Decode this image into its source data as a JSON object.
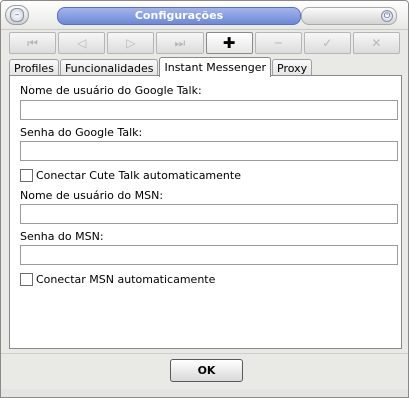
{
  "window": {
    "title": "Configurações",
    "minimize_icon": "minimize-icon",
    "close_icon": "close-icon"
  },
  "toolbar": {
    "buttons": [
      {
        "icon": "skip-back-icon",
        "glyph": "⏮",
        "enabled": false
      },
      {
        "icon": "back-icon",
        "glyph": "◁",
        "enabled": false
      },
      {
        "icon": "play-icon",
        "glyph": "▷",
        "enabled": false
      },
      {
        "icon": "skip-forward-icon",
        "glyph": "⏭",
        "enabled": false
      },
      {
        "icon": "add-icon",
        "glyph": "✚",
        "enabled": true
      },
      {
        "icon": "remove-icon",
        "glyph": "─",
        "enabled": false
      },
      {
        "icon": "check-icon",
        "glyph": "✓",
        "enabled": false
      },
      {
        "icon": "cancel-icon",
        "glyph": "✕",
        "enabled": false
      }
    ]
  },
  "tabs": [
    {
      "label": "Profiles",
      "active": false
    },
    {
      "label": "Funcionalidades",
      "active": false
    },
    {
      "label": "Instant Messenger",
      "active": true
    },
    {
      "label": "Proxy",
      "active": false
    }
  ],
  "form": {
    "gtalk_user_label": "Nome de usuário do Google Talk:",
    "gtalk_user_value": "",
    "gtalk_pass_label": "Senha do Google Talk:",
    "gtalk_pass_value": "",
    "gtalk_auto_label": "Conectar Cute Talk automaticamente",
    "gtalk_auto_checked": false,
    "msn_user_label": "Nome de usuário do MSN:",
    "msn_user_value": "",
    "msn_pass_label": "Senha do MSN:",
    "msn_pass_value": "",
    "msn_auto_label": "Conectar MSN automaticamente",
    "msn_auto_checked": false
  },
  "footer": {
    "ok_label": "OK"
  }
}
